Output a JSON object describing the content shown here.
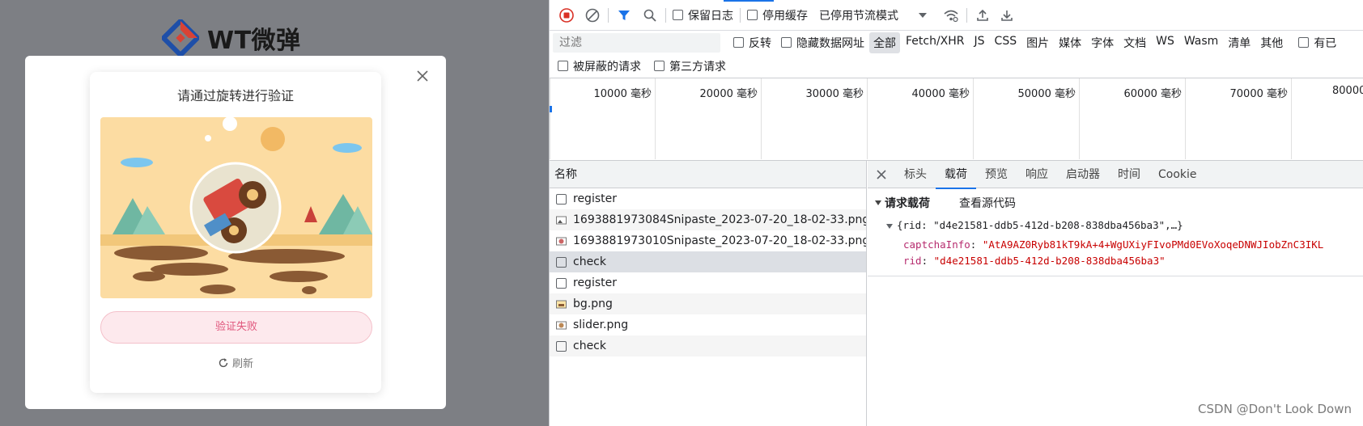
{
  "site": {
    "logo_text": "WT微弹",
    "captcha": {
      "title": "请通过旋转进行验证",
      "status": "验证失败",
      "refresh": "刷新"
    }
  },
  "devtools": {
    "toolbar": {
      "preserve_log": "保留日志",
      "disable_cache": "停用缓存",
      "throttle": "已停用节流模式"
    },
    "filter": {
      "placeholder": "过滤",
      "invert": "反转",
      "hide_data_urls": "隐藏数据网址",
      "types": [
        "全部",
        "Fetch/XHR",
        "JS",
        "CSS",
        "图片",
        "媒体",
        "字体",
        "文档",
        "WS",
        "Wasm",
        "清单",
        "其他"
      ],
      "has_blocked_cookies": "有已",
      "blocked_requests": "被屏蔽的请求",
      "third_party": "第三方请求"
    },
    "overview_ticks": [
      "10000 毫秒",
      "20000 毫秒",
      "30000 毫秒",
      "40000 毫秒",
      "50000 毫秒",
      "60000 毫秒",
      "70000 毫秒",
      "80000"
    ],
    "requests": {
      "header": "名称",
      "rows": [
        {
          "name": "register",
          "icon": "doc"
        },
        {
          "name": "1693881973084Snipaste_2023-07-20_18-02-33.png",
          "icon": "image"
        },
        {
          "name": "1693881973010Snipaste_2023-07-20_18-02-33.png",
          "icon": "image"
        },
        {
          "name": "check",
          "icon": "doc"
        },
        {
          "name": "register",
          "icon": "doc"
        },
        {
          "name": "bg.png",
          "icon": "image"
        },
        {
          "name": "slider.png",
          "icon": "image"
        },
        {
          "name": "check",
          "icon": "doc"
        }
      ]
    },
    "details": {
      "tabs": [
        "标头",
        "载荷",
        "预览",
        "响应",
        "启动器",
        "时间",
        "Cookie"
      ],
      "active_tab": "载荷",
      "payload_title": "请求载荷",
      "view_source": "查看源代码",
      "summary": "{rid: \"d4e21581-ddb5-412d-b208-838dba456ba3\",…}",
      "fields": [
        {
          "key": "captchaInfo",
          "value": "\"AtA9AZ0Ryb81kT9kA+4+WgUXiyFIvoPMd0EVoXoqeDNWJIobZnC3IKL"
        },
        {
          "key": "rid",
          "value": "\"d4e21581-ddb5-412d-b208-838dba456ba3\""
        }
      ]
    }
  },
  "watermark": "CSDN @Don't Look Down"
}
